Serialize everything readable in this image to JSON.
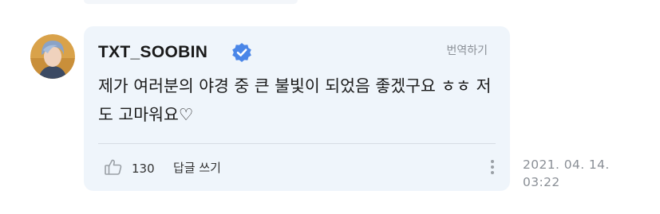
{
  "comment": {
    "author": "TXT_SOOBIN",
    "verified": true,
    "translate_label": "번역하기",
    "text": "제가 여러분의 야경 중 큰 불빛이 되었음 좋겠구요 ㅎㅎ 저도 고마워요♡",
    "like_count": "130",
    "reply_label": "답글 쓰기",
    "date": "2021. 04. 14.",
    "time": "03:22"
  },
  "icons": {
    "verified": "verified-badge-icon",
    "like": "thumbs-up-icon",
    "more": "more-vertical-icon"
  },
  "colors": {
    "bubble_bg": "#eff5fb",
    "verified_blue": "#4a86e8",
    "muted_text": "#8a8f96"
  }
}
